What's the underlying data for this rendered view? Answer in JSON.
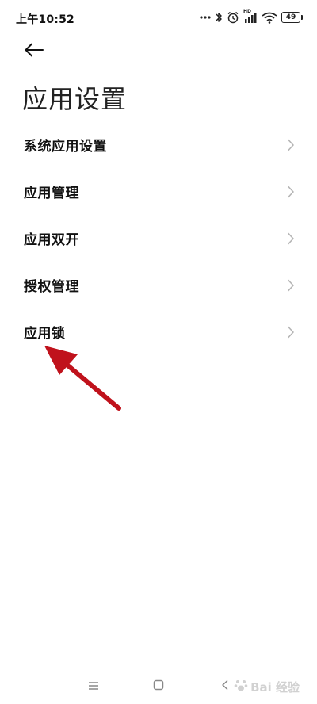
{
  "status_bar": {
    "time": "上午10:52",
    "hd_label": "HD",
    "battery_level": "49"
  },
  "header": {
    "title": "应用设置"
  },
  "settings": {
    "items": [
      {
        "label": "系统应用设置"
      },
      {
        "label": "应用管理"
      },
      {
        "label": "应用双开"
      },
      {
        "label": "授权管理"
      },
      {
        "label": "应用锁"
      }
    ]
  },
  "annotation": {
    "arrow_color": "#c0121c"
  },
  "watermark": {
    "text": "Bai 经验"
  },
  "icons": {
    "back": "arrow-left-icon",
    "chevron": "chevron-right-icon",
    "nav_menu": "menu-icon",
    "nav_home": "home-square-icon",
    "nav_back": "back-triangle-icon"
  }
}
